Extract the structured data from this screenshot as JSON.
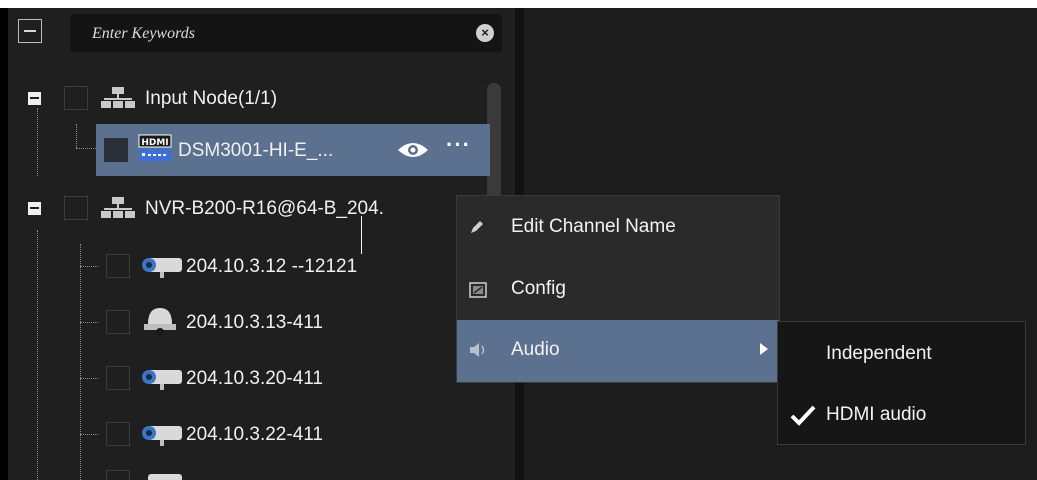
{
  "search": {
    "placeholder": "Enter Keywords"
  },
  "tree": {
    "nodes": [
      {
        "label": "Input Node(1/1)",
        "icon": "network-icon"
      },
      {
        "label": "DSM3001-HI-E_...",
        "icon": "hdmi-device-icon",
        "badge": "HDMI",
        "selected": true
      },
      {
        "label": "NVR-B200-R16@64-B_204.",
        "icon": "network-icon"
      },
      {
        "label": "204.10.3.12  --12121",
        "icon": "bullet-camera-icon"
      },
      {
        "label": "204.10.3.13-411",
        "icon": "dome-camera-icon"
      },
      {
        "label": "204.10.3.20-411",
        "icon": "bullet-camera-icon"
      },
      {
        "label": "204.10.3.22-411",
        "icon": "bullet-camera-icon"
      }
    ]
  },
  "context_menu": {
    "items": [
      {
        "label": "Edit Channel Name",
        "icon": "pencil-icon"
      },
      {
        "label": "Config",
        "icon": "config-icon"
      },
      {
        "label": "Audio",
        "icon": "speaker-icon",
        "active": true
      }
    ]
  },
  "audio_submenu": {
    "items": [
      {
        "label": "Independent",
        "checked": false
      },
      {
        "label": "HDMI audio",
        "checked": true
      }
    ]
  },
  "colors": {
    "selection": "#5c7090",
    "panel": "#1f1f1f",
    "menu": "#2a2a2a"
  }
}
